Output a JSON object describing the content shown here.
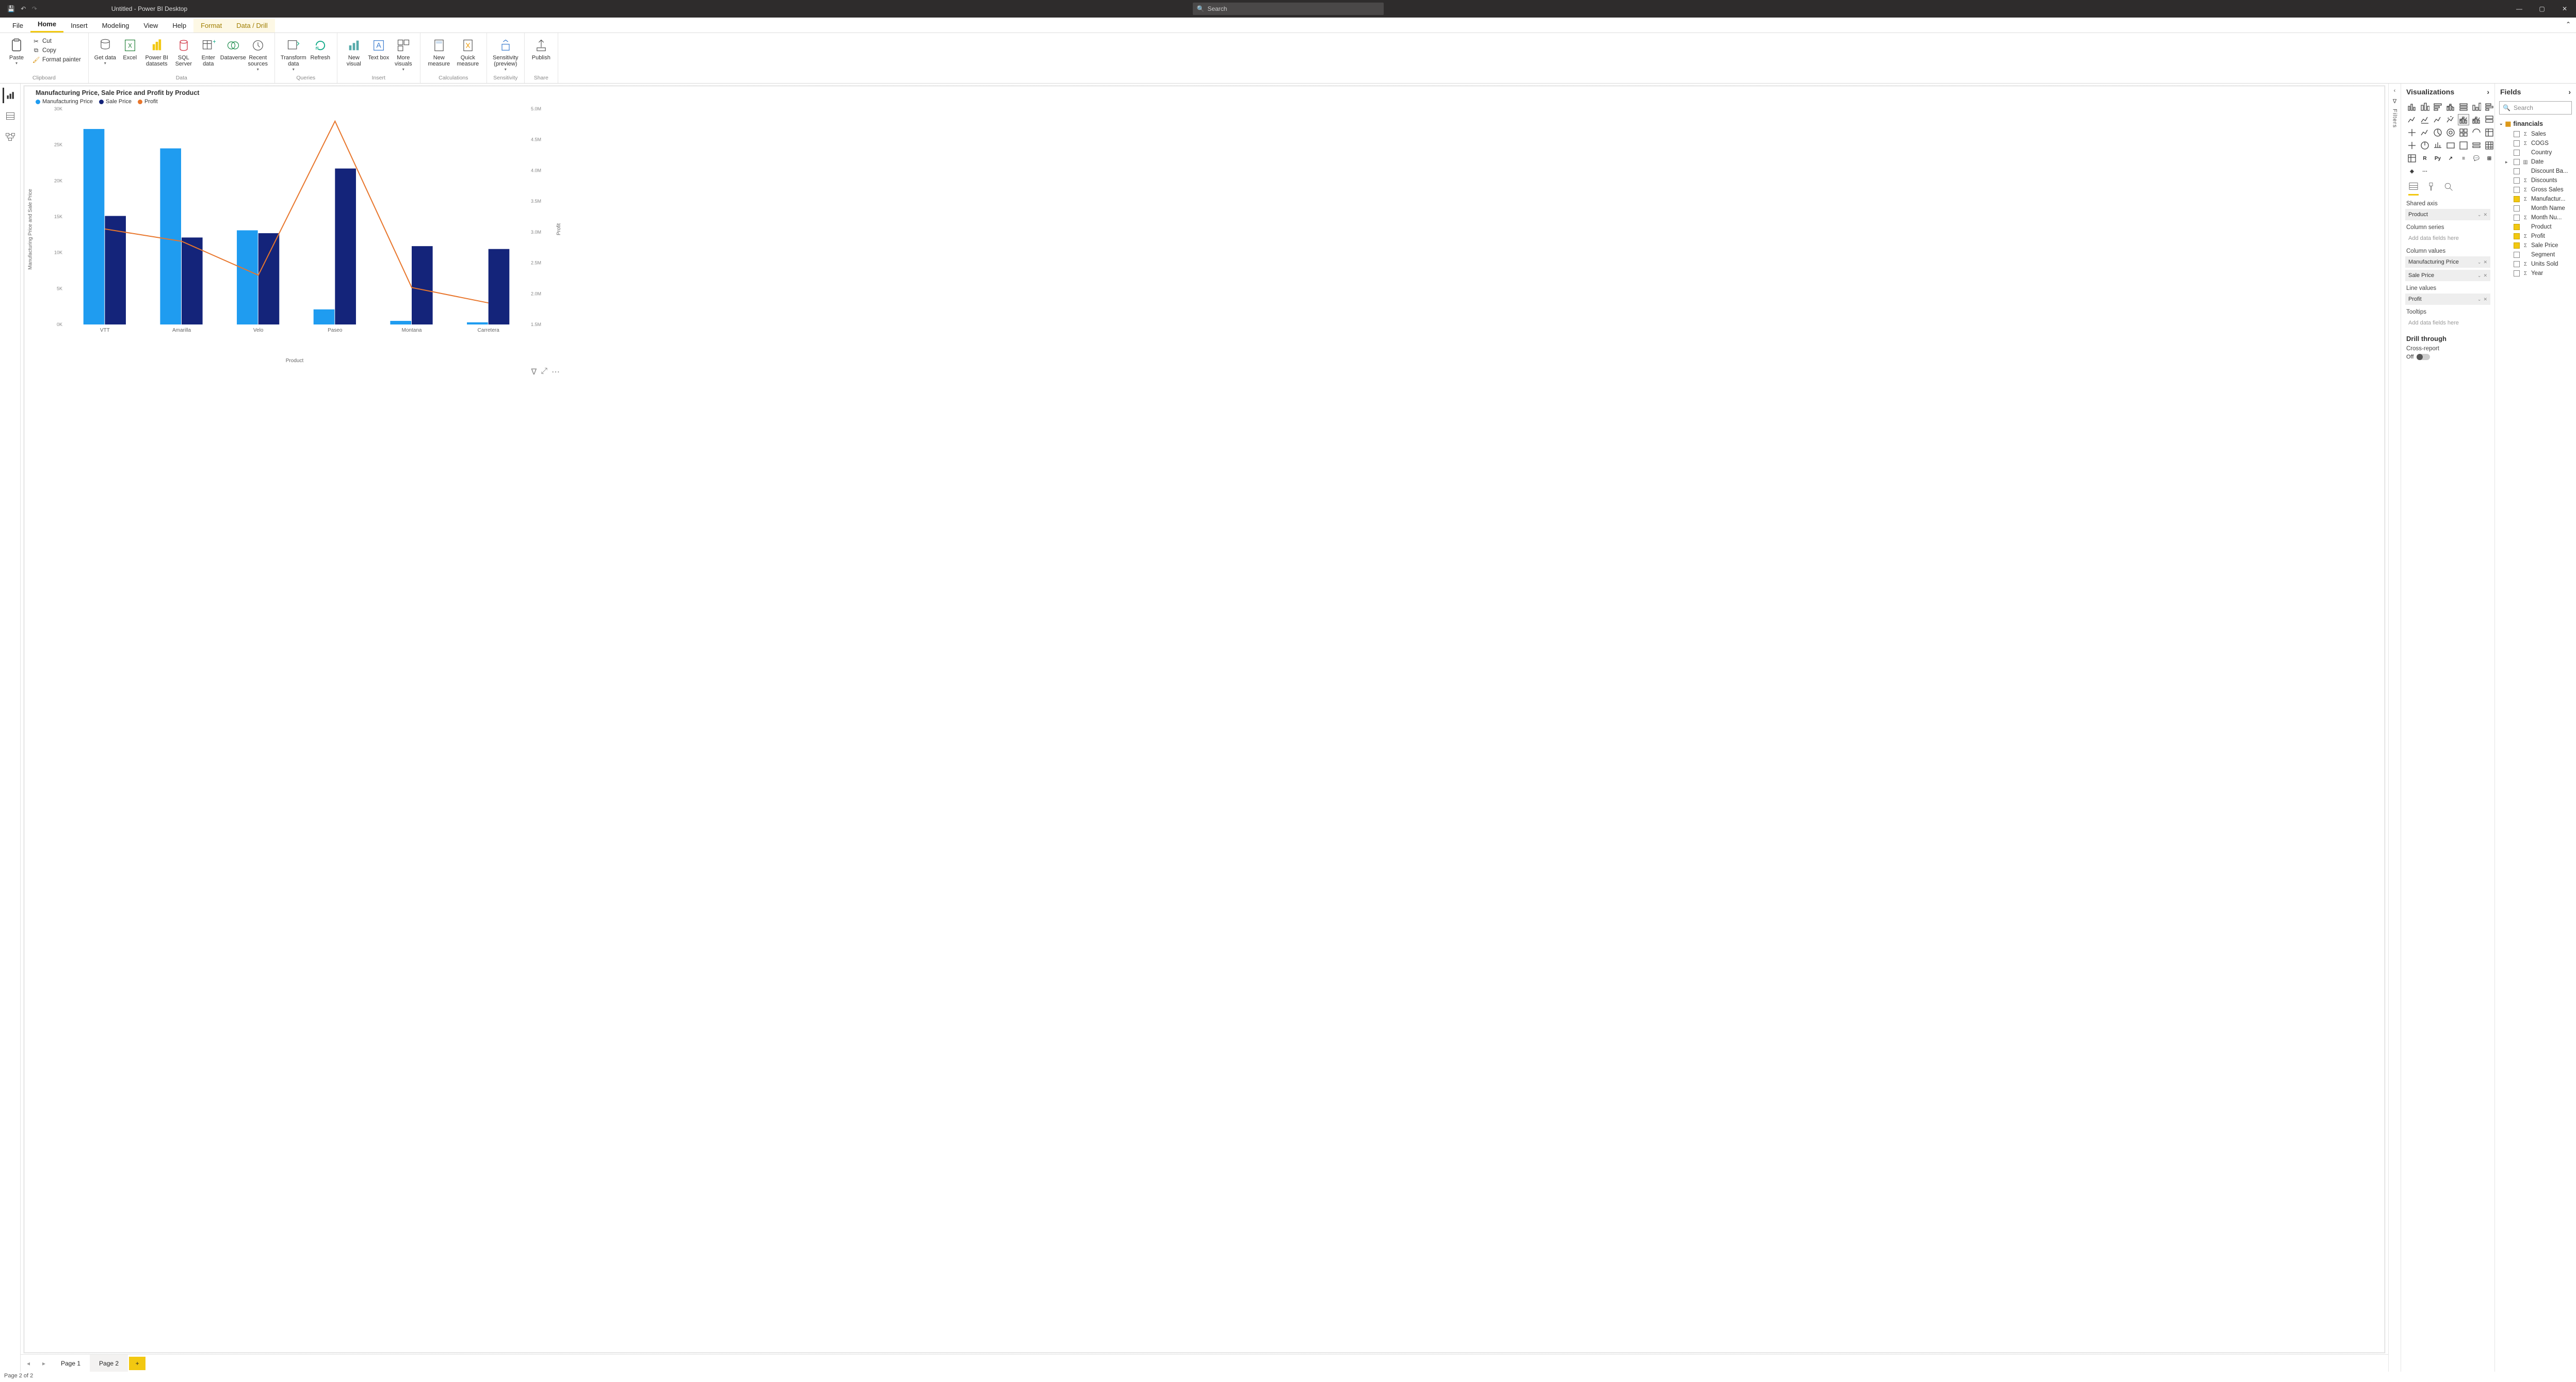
{
  "titlebar": {
    "title": "Untitled - Power BI Desktop",
    "search_placeholder": "Search"
  },
  "tabs": {
    "file": "File",
    "home": "Home",
    "insert": "Insert",
    "modeling": "Modeling",
    "view": "View",
    "help": "Help",
    "format": "Format",
    "datadrill": "Data / Drill"
  },
  "ribbon": {
    "paste": "Paste",
    "cut": "Cut",
    "copy": "Copy",
    "format_painter": "Format painter",
    "clipboard": "Clipboard",
    "get_data": "Get data",
    "excel": "Excel",
    "pbi_datasets": "Power BI datasets",
    "sql": "SQL Server",
    "enter_data": "Enter data",
    "dataverse": "Dataverse",
    "recent_sources": "Recent sources",
    "data": "Data",
    "transform": "Transform data",
    "refresh": "Refresh",
    "queries": "Queries",
    "new_visual": "New visual",
    "text_box": "Text box",
    "more_visuals": "More visuals",
    "insert": "Insert",
    "new_measure": "New measure",
    "quick_measure": "Quick measure",
    "calculations": "Calculations",
    "sensitivity": "Sensitivity (preview)",
    "sensitivity_grp": "Sensitivity",
    "publish": "Publish",
    "share": "Share"
  },
  "pages": {
    "p1": "Page 1",
    "p2": "Page 2"
  },
  "status": "Page 2 of 2",
  "filters_label": "Filters",
  "viz_pane": {
    "title": "Visualizations",
    "shared_axis": "Shared axis",
    "column_series": "Column series",
    "column_values": "Column values",
    "line_values": "Line values",
    "tooltips": "Tooltips",
    "add_fields": "Add data fields here",
    "well_product": "Product",
    "well_mfg": "Manufacturing Price",
    "well_sale": "Sale Price",
    "well_profit": "Profit",
    "drill_through": "Drill through",
    "cross_report": "Cross-report",
    "off": "Off"
  },
  "fields_pane": {
    "title": "Fields",
    "search_placeholder": "Search",
    "table": "financials",
    "fields": [
      {
        "name": "Sales",
        "sigma": true,
        "checked": false
      },
      {
        "name": "COGS",
        "sigma": true,
        "checked": false
      },
      {
        "name": "Country",
        "sigma": false,
        "checked": false
      },
      {
        "name": "Date",
        "sigma": false,
        "checked": false,
        "hier": true
      },
      {
        "name": "Discount Ba...",
        "sigma": false,
        "checked": false
      },
      {
        "name": "Discounts",
        "sigma": true,
        "checked": false
      },
      {
        "name": "Gross Sales",
        "sigma": true,
        "checked": false
      },
      {
        "name": "Manufactur...",
        "sigma": true,
        "checked": true
      },
      {
        "name": "Month Name",
        "sigma": false,
        "checked": false
      },
      {
        "name": "Month Nu...",
        "sigma": true,
        "checked": false
      },
      {
        "name": "Product",
        "sigma": false,
        "checked": true
      },
      {
        "name": "Profit",
        "sigma": true,
        "checked": true
      },
      {
        "name": "Sale Price",
        "sigma": true,
        "checked": true
      },
      {
        "name": "Segment",
        "sigma": false,
        "checked": false
      },
      {
        "name": "Units Sold",
        "sigma": true,
        "checked": false
      },
      {
        "name": "Year",
        "sigma": true,
        "checked": false
      }
    ]
  },
  "chart_data": {
    "type": "bar+line",
    "title": "Manufacturing Price, Sale Price and Profit by Product",
    "xlabel": "Product",
    "ylabel_left": "Manufacturing Price and Sale Price",
    "ylabel_right": "Profit",
    "categories": [
      "VTT",
      "Amarilla",
      "Velo",
      "Paseo",
      "Montana",
      "Carretera"
    ],
    "ylim_left": [
      0,
      30000
    ],
    "ylim_right": [
      1500000,
      5000000
    ],
    "y_left_ticks": [
      "0K",
      "5K",
      "10K",
      "15K",
      "20K",
      "25K",
      "30K"
    ],
    "y_right_ticks": [
      "1.5M",
      "2.0M",
      "2.5M",
      "3.0M",
      "3.5M",
      "4.0M",
      "4.5M",
      "5.0M"
    ],
    "series_bars": [
      {
        "name": "Manufacturing Price",
        "color": "#1f9cf0",
        "values": [
          27200,
          24500,
          13100,
          2100,
          500,
          300
        ]
      },
      {
        "name": "Sale Price",
        "color": "#14247a",
        "values": [
          15100,
          12100,
          12700,
          21700,
          10900,
          10500
        ]
      }
    ],
    "series_line": {
      "name": "Profit",
      "color": "#e8762c",
      "values": [
        3050000,
        2850000,
        2300000,
        4800000,
        2100000,
        1850000
      ]
    }
  },
  "legend": {
    "a": "Manufacturing Price",
    "b": "Sale Price",
    "c": "Profit"
  }
}
